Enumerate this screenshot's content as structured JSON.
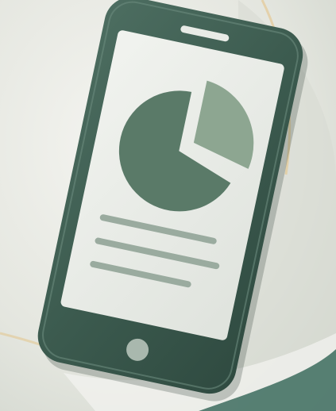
{
  "illustration": {
    "subject": "tablet-with-pie-chart",
    "icon": "pie-chart-icon",
    "colors": {
      "background": "#e9eae4",
      "background_shade": "#d7dad2",
      "accent_curve": "#e3cc9d",
      "device_body": "#3f5e52",
      "device_highlight": "#557568",
      "screen": "#e8ebe6",
      "pie_main": "#5a7a68",
      "pie_slice": "#8da691",
      "text_lines": "#9aab9f",
      "home_button": "#a9b8ae",
      "bottom_teal": "#3f6e62"
    },
    "pie_chart": {
      "slices": [
        0.8,
        0.2
      ]
    },
    "text_line_count": 3
  }
}
